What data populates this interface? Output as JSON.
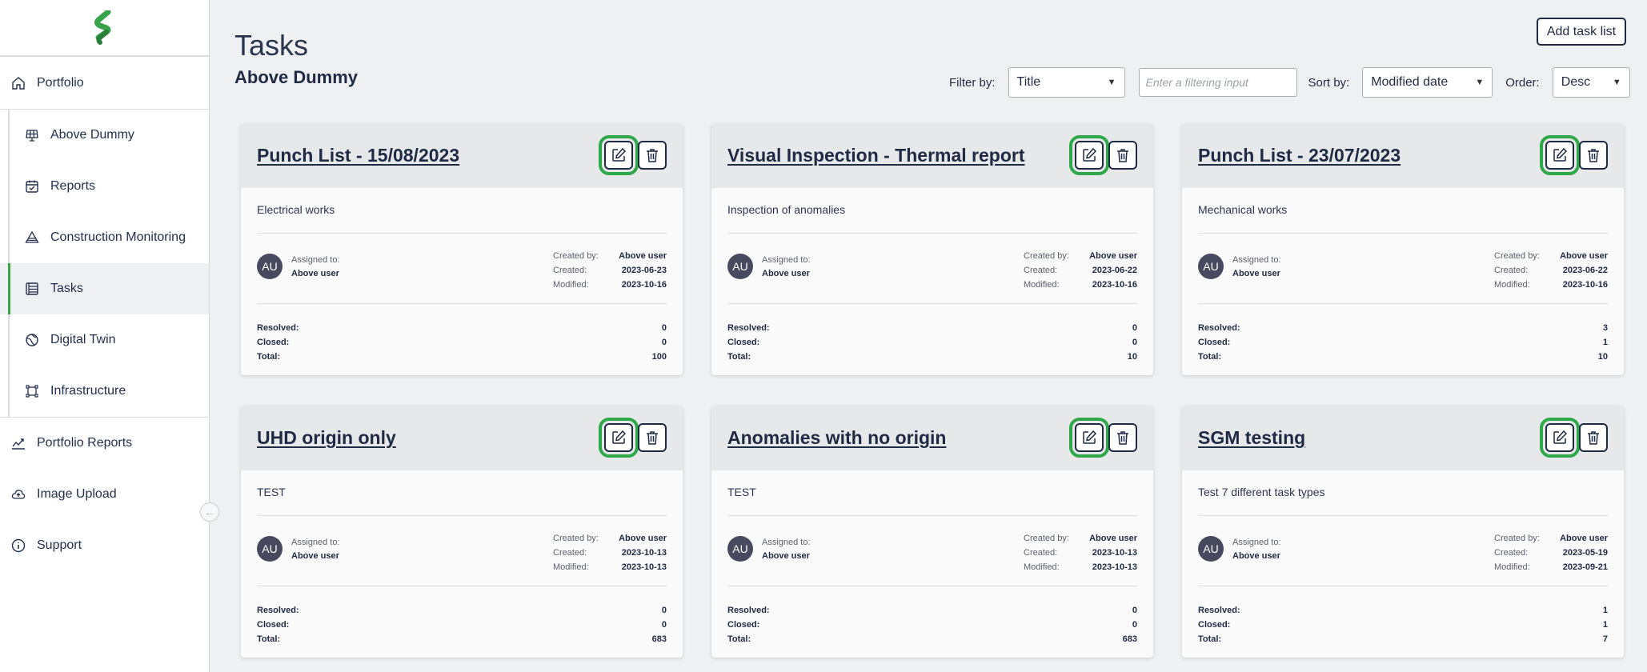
{
  "app": {
    "brand_color": "#39a34b",
    "highlight_color": "#2fa84a"
  },
  "sidebar": {
    "top_item": {
      "label": "Portfolio",
      "icon": "home-icon"
    },
    "sub_items": [
      {
        "label": "Above Dummy",
        "icon": "solar-panel-icon"
      },
      {
        "label": "Reports",
        "icon": "calendar-check-icon"
      },
      {
        "label": "Construction Monitoring",
        "icon": "construction-icon"
      },
      {
        "label": "Tasks",
        "icon": "tasks-list-icon",
        "active": true
      },
      {
        "label": "Digital Twin",
        "icon": "globe-icon"
      },
      {
        "label": "Infrastructure",
        "icon": "infrastructure-icon"
      }
    ],
    "bottom_items": [
      {
        "label": "Portfolio Reports",
        "icon": "chart-line-icon"
      },
      {
        "label": "Image Upload",
        "icon": "cloud-upload-icon"
      },
      {
        "label": "Support",
        "icon": "info-icon"
      }
    ]
  },
  "header": {
    "title": "Tasks",
    "project": "Above Dummy",
    "add_button": "Add task list"
  },
  "filters": {
    "filter_by_label": "Filter by:",
    "filter_by_value": "Title",
    "filter_input_placeholder": "Enter a filtering input",
    "sort_by_label": "Sort by:",
    "sort_by_value": "Modified date",
    "order_label": "Order:",
    "order_value": "Desc"
  },
  "labels": {
    "assigned_to": "Assigned to:",
    "created_by": "Created by:",
    "created": "Created:",
    "modified": "Modified:",
    "resolved": "Resolved:",
    "closed": "Closed:",
    "total": "Total:"
  },
  "cards": [
    {
      "title": "Punch List - 15/08/2023",
      "description": "Electrical works",
      "avatar": "AU",
      "assigned_to": "Above user",
      "created_by": "Above user",
      "created": "2023-06-23",
      "modified": "2023-10-16",
      "resolved": "0",
      "closed": "0",
      "total": "100"
    },
    {
      "title": "Visual Inspection - Thermal report",
      "description": "Inspection of anomalies",
      "avatar": "AU",
      "assigned_to": "Above user",
      "created_by": "Above user",
      "created": "2023-06-22",
      "modified": "2023-10-16",
      "resolved": "0",
      "closed": "0",
      "total": "10"
    },
    {
      "title": "Punch List - 23/07/2023",
      "description": "Mechanical works",
      "avatar": "AU",
      "assigned_to": "Above user",
      "created_by": "Above user",
      "created": "2023-06-22",
      "modified": "2023-10-16",
      "resolved": "3",
      "closed": "1",
      "total": "10"
    },
    {
      "title": "UHD origin only",
      "description": "TEST",
      "avatar": "AU",
      "assigned_to": "Above user",
      "created_by": "Above user",
      "created": "2023-10-13",
      "modified": "2023-10-13",
      "resolved": "0",
      "closed": "0",
      "total": "683"
    },
    {
      "title": "Anomalies with no origin",
      "description": "TEST",
      "avatar": "AU",
      "assigned_to": "Above user",
      "created_by": "Above user",
      "created": "2023-10-13",
      "modified": "2023-10-13",
      "resolved": "0",
      "closed": "0",
      "total": "683"
    },
    {
      "title": "SGM testing",
      "description": "Test 7 different task types",
      "avatar": "AU",
      "assigned_to": "Above user",
      "created_by": "Above user",
      "created": "2023-05-19",
      "modified": "2023-09-21",
      "resolved": "1",
      "closed": "1",
      "total": "7"
    }
  ]
}
